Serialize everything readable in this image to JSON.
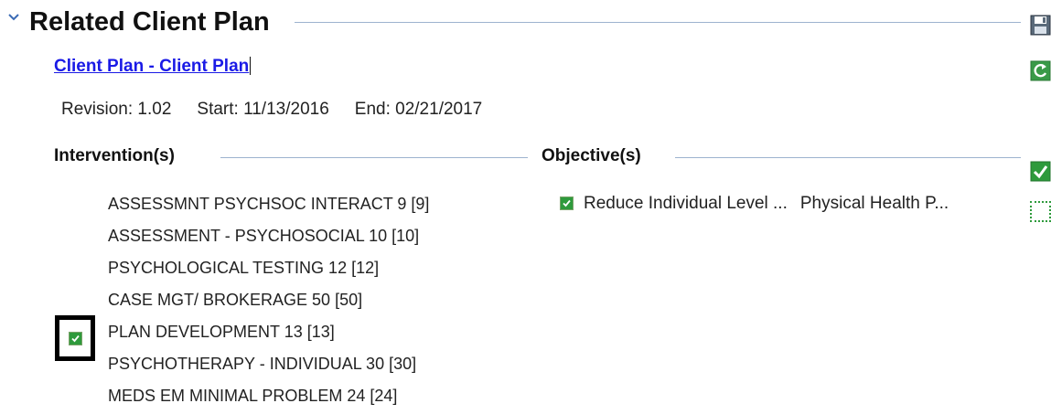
{
  "section": {
    "title": "Related Client Plan",
    "chevron_icon": "chevron-down-icon"
  },
  "plan": {
    "link_label": "Client Plan - Client Plan",
    "revision": "Revision: 1.02",
    "start": "Start: 11/13/2016",
    "end": "End: 02/21/2017"
  },
  "interventions": {
    "title": "Intervention(s)",
    "items": [
      {
        "label": "ASSESSMNT PSYCHSOC INTERACT 9 [9]",
        "checked": false
      },
      {
        "label": "ASSESSMENT - PSYCHOSOCIAL 10 [10]",
        "checked": false
      },
      {
        "label": "PSYCHOLOGICAL TESTING 12 [12]",
        "checked": false
      },
      {
        "label": "CASE MGT/ BROKERAGE 50 [50]",
        "checked": false
      },
      {
        "label": "PLAN DEVELOPMENT 13 [13]",
        "checked": true
      },
      {
        "label": "PSYCHOTHERAPY -  INDIVIDUAL 30 [30]",
        "checked": false
      },
      {
        "label": "MEDS EM MINIMAL PROBLEM 24 [24]",
        "checked": false
      }
    ]
  },
  "objectives": {
    "title": "Objective(s)",
    "items": [
      {
        "text": "Reduce Individual Level ...",
        "area": "Physical Health P...",
        "checked": true
      }
    ]
  },
  "toolbar": {
    "icons": [
      "save-icon",
      "refresh-icon",
      "check-icon",
      "dotted-select-icon"
    ]
  },
  "colors": {
    "link": "#1a1ae6",
    "rule": "#9db3cf",
    "check_green": "#2e9a3c"
  }
}
